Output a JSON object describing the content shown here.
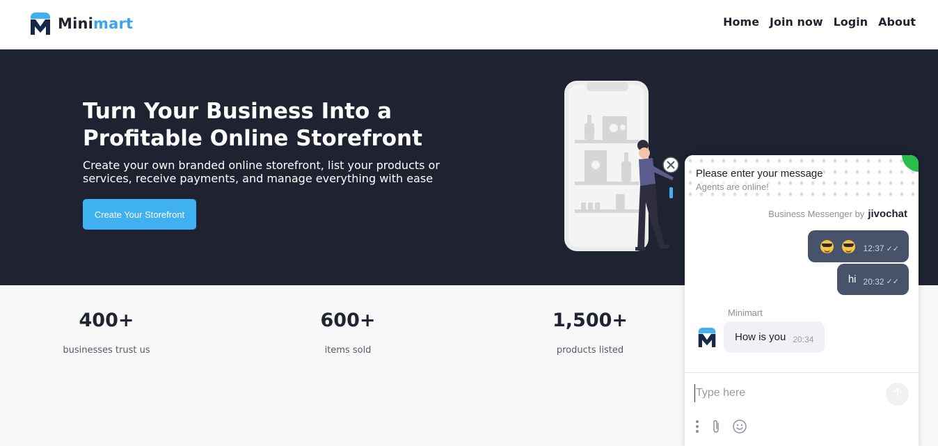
{
  "header": {
    "logo_text_1": "Mini",
    "logo_text_2": "mart",
    "nav": [
      "Home",
      "Join now",
      "Login",
      "About"
    ]
  },
  "hero": {
    "title": "Turn Your Business Into a Profitable Online Storefront",
    "subtitle": "Create your own branded online storefront, list your products or services, receive payments, and manage everything with ease",
    "cta_label": "Create Your Storefront"
  },
  "stats": [
    {
      "value": "400+",
      "label": "businesses trust us"
    },
    {
      "value": "600+",
      "label": "items sold"
    },
    {
      "value": "1,500+",
      "label": "products listed"
    }
  ],
  "chat": {
    "title": "Please enter your message",
    "status": "Agents are online!",
    "brand_prefix": "Business Messenger by",
    "brand_name": "jivochat",
    "messages_out": [
      {
        "text": "",
        "time": "12:37",
        "emoji_count": 2
      },
      {
        "text": "hi",
        "time": "20:32"
      }
    ],
    "agent_name": "Minimart",
    "message_in": {
      "text": "How is you",
      "time": "20:34"
    },
    "input_placeholder": "Type here",
    "icons": [
      "more-icon",
      "attach-icon",
      "emoji-icon",
      "send-arrow-icon",
      "close-icon"
    ]
  },
  "colors": {
    "hero_bg": "#1e2231",
    "accent_blue": "#3fb1f0",
    "chat_bubble_out": "#46536a",
    "online_green": "#2bbd4a"
  }
}
